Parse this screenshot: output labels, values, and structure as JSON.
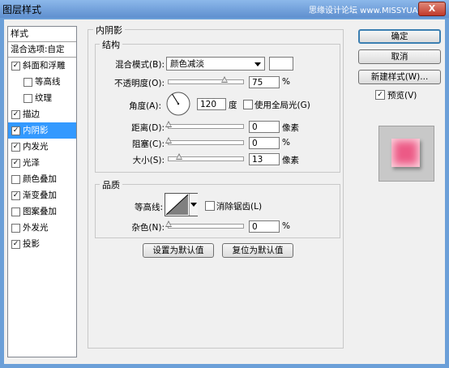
{
  "window": {
    "title": "图层样式",
    "watermark": "思缘设计论坛 www.MISSYUAN.COM",
    "close": "X"
  },
  "styles_list": {
    "header": "样式",
    "blend_options": "混合选项:自定",
    "items": [
      {
        "label": "斜面和浮雕",
        "checked": true
      },
      {
        "label": "等高线",
        "checked": false
      },
      {
        "label": "纹理",
        "checked": false
      },
      {
        "label": "描边",
        "checked": true
      },
      {
        "label": "内阴影",
        "checked": true
      },
      {
        "label": "内发光",
        "checked": true
      },
      {
        "label": "光泽",
        "checked": true
      },
      {
        "label": "颜色叠加",
        "checked": false
      },
      {
        "label": "渐变叠加",
        "checked": true
      },
      {
        "label": "图案叠加",
        "checked": false
      },
      {
        "label": "外发光",
        "checked": false
      },
      {
        "label": "投影",
        "checked": true
      }
    ]
  },
  "panel": {
    "title": "内阴影",
    "structure": {
      "title": "结构",
      "blend_mode_label": "混合模式(B):",
      "blend_mode_value": "颜色减淡",
      "opacity_label": "不透明度(O):",
      "opacity_value": "75",
      "opacity_fraction": 0.75,
      "percent": "%",
      "angle_label": "角度(A):",
      "angle_value": "120",
      "degree": "度",
      "global_light_label": "使用全局光(G)",
      "global_light_checked": false,
      "distance_label": "距离(D):",
      "distance_value": "0",
      "pixels": "像素",
      "choke_label": "阻塞(C):",
      "choke_value": "0",
      "size_label": "大小(S):",
      "size_value": "13",
      "size_fraction": 0.05
    },
    "quality": {
      "title": "品质",
      "contour_label": "等高线:",
      "antialias_label": "消除锯齿(L)",
      "antialias_checked": false,
      "noise_label": "杂色(N):",
      "noise_value": "0"
    },
    "buttons": {
      "set_default": "设置为默认值",
      "reset_default": "复位为默认值"
    }
  },
  "right": {
    "ok": "确定",
    "cancel": "取消",
    "new_style": "新建样式(W)...",
    "preview_label": "预览(V)",
    "preview_checked": true,
    "preview_color": "#ec5a86"
  }
}
